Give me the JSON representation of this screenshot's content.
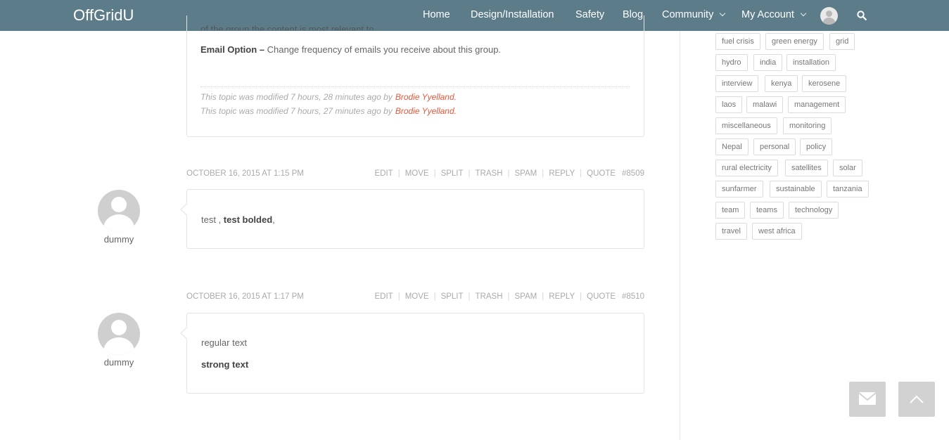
{
  "brand": {
    "logo": "OffGridU"
  },
  "nav": {
    "items": [
      "Home",
      "Design/Installation",
      "Safety",
      "Blog",
      "Community",
      "My Account"
    ]
  },
  "icons": {
    "avatar": "user-avatar-icon",
    "search": "search-icon",
    "email": "envelope-icon",
    "top": "chevron-up-icon"
  },
  "colors": {
    "header": "#5c7c8a",
    "link": "#e8573b",
    "muted": "#aaaaaa"
  },
  "topic": {
    "clipped_text": "of the group the content is most relevant to.",
    "email_label": "Email Option –",
    "email_text": " Change frequency of emails you receive about this group.",
    "mod_text": "This topic was modified 7 hours, 28 minutes ago by",
    "mod_text_2": "This topic was modified 7 hours, 27 minutes ago by",
    "mod_author": "Brodie Yyelland."
  },
  "actions": [
    "EDIT",
    "MOVE",
    "SPLIT",
    "TRASH",
    "SPAM",
    "REPLY",
    "QUOTE"
  ],
  "replies": [
    {
      "date": "OCTOBER 16, 2015 AT 1:15 PM",
      "id": "#8509",
      "author": "dummy",
      "text_plain": "test , ",
      "text_bold": "test bolded",
      "text_after": ","
    },
    {
      "date": "OCTOBER 16, 2015 AT 1:17 PM",
      "id": "#8510",
      "author": "dummy",
      "line1": "regular text",
      "line2": "strong text"
    }
  ],
  "tags": [
    "fuel crisis",
    "green energy",
    "grid",
    "hydro",
    "india",
    "installation",
    "interview",
    "kenya",
    "kerosene",
    "laos",
    "malawi",
    "management",
    "miscellaneous",
    "monitoring",
    "Nepal",
    "personal",
    "policy",
    "rural electricity",
    "satellites",
    "solar",
    "sunfarmer",
    "sustainable",
    "tanzania",
    "team",
    "teams",
    "technology",
    "travel",
    "west africa"
  ]
}
